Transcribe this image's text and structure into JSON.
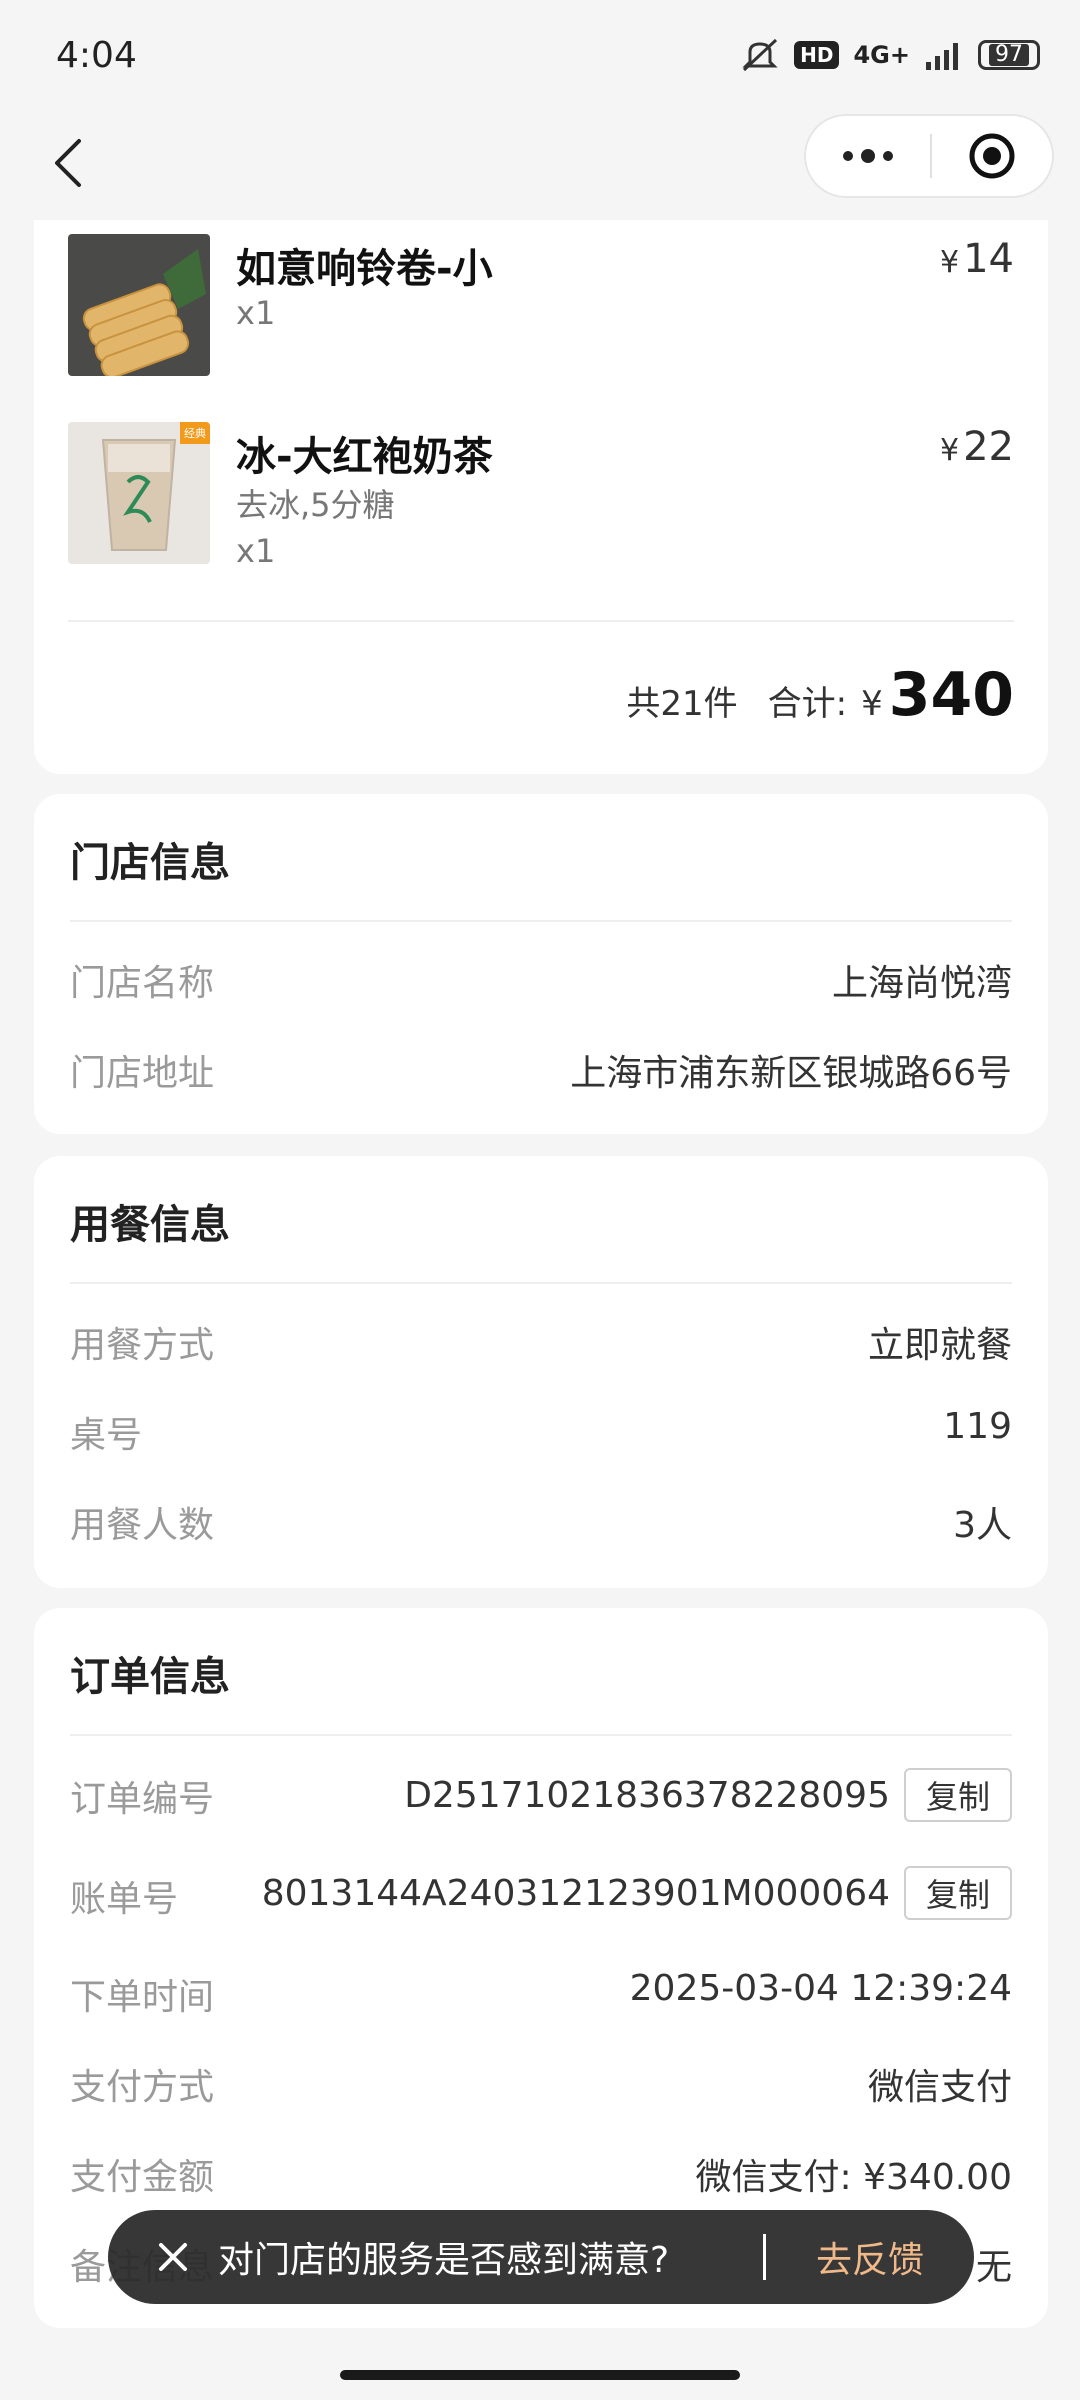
{
  "status_bar": {
    "time": "4:04",
    "hd": "HD",
    "network": "4G+",
    "battery": "97"
  },
  "nav": {},
  "items": [
    {
      "name": "如意响铃卷-小",
      "options": "",
      "qty": "x1",
      "currency": "¥",
      "price": "14"
    },
    {
      "name": "冰-大红袍奶茶",
      "options": "去冰,5分糖",
      "qty": "x1",
      "currency": "¥",
      "price": "22",
      "badge": "经典"
    }
  ],
  "summary": {
    "count": "共21件",
    "total_label": "合计:",
    "currency": "¥",
    "total": "340"
  },
  "store": {
    "title": "门店信息",
    "name_label": "门店名称",
    "name": "上海尚悦湾",
    "address_label": "门店地址",
    "address": "上海市浦东新区银城路66号"
  },
  "dining": {
    "title": "用餐信息",
    "mode_label": "用餐方式",
    "mode": "立即就餐",
    "table_label": "桌号",
    "table": "119",
    "people_label": "用餐人数",
    "people": "3人"
  },
  "order": {
    "title": "订单信息",
    "order_no_label": "订单编号",
    "order_no": "D25171021836378228095",
    "bill_no_label": "账单号",
    "bill_no": "8013144A240312123901M000064",
    "copy_label": "复制",
    "time_label": "下单时间",
    "time": "2025-03-04 12:39:24",
    "pay_method_label": "支付方式",
    "pay_method": "微信支付",
    "pay_amount_label": "支付金额",
    "pay_amount": "微信支付: ¥340.00",
    "remark_label": "备注信息",
    "remark": "无"
  },
  "toast": {
    "text": "对门店的服务是否感到满意?",
    "link": "去反馈"
  },
  "colors": {
    "accent_link": "#f0b98a",
    "label_gray": "#9a9a9a",
    "background": "#f5f5f5"
  }
}
